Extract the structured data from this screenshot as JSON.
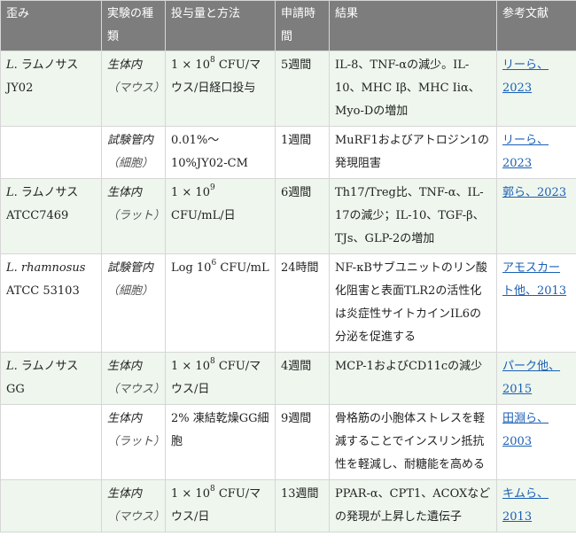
{
  "headers": [
    "歪み",
    "実験の種類",
    "投与量と方法",
    "申請時間",
    "結果",
    "参考文献"
  ],
  "rows": [
    {
      "strain_prefix": "L.",
      "strain_name": " ラムノサスJY02",
      "type_main": "生体内",
      "type_sub": "（マウス）",
      "dose_before": "1 × 10",
      "dose_sup": "8",
      "dose_after": " CFU/マウス/日経口投与",
      "duration": "5週間",
      "result": "IL-8、TNF-αの減少。IL-10、MHC Iβ、MHC Iiα、Myo-Dの増加",
      "ref": "リーら、2023"
    },
    {
      "strain_prefix": "",
      "strain_name": "",
      "type_main": "試験管内",
      "type_sub": "（細胞）",
      "dose_before": "0.01%～10%JY02-CM",
      "dose_sup": "",
      "dose_after": "",
      "duration": "1週間",
      "result": "MuRF1およびアトロジン1の発現阻害",
      "ref": "リーら、2023"
    },
    {
      "strain_prefix": "L.",
      "strain_name": " ラムノサスATCC7469",
      "type_main": "生体内",
      "type_sub": "（ラット）",
      "dose_before": "1 × 10",
      "dose_sup": "9",
      "dose_after": " CFU/mL/日",
      "duration": "6週間",
      "result": "Th17/Treg比、TNF-α、IL-17の減少；IL-10、TGF-β、TJs、GLP-2の増加",
      "ref": "郭ら、2023"
    },
    {
      "strain_prefix": "L. rhamnosus",
      "strain_name": "ATCC 53103",
      "type_main": "試験管内",
      "type_sub": "（細胞）",
      "dose_before": "Log 10",
      "dose_sup": "6",
      "dose_after": "  CFU/mL",
      "duration": "24時間",
      "result": "NF-κBサブユニットのリン酸化阻害と表面TLR2の活性化は炎症性サイトカインIL6の分泌を促進する",
      "ref": "アモスカート他、2013"
    },
    {
      "strain_prefix": "L.",
      "strain_name": " ラムノサスGG",
      "type_main": "生体内",
      "type_sub": "（マウス）",
      "dose_before": "1 × 10",
      "dose_sup": "8",
      "dose_after": " CFU/マウス/日",
      "duration": "4週間",
      "result": "MCP-1およびCD11cの減少",
      "ref": "パーク他、2015"
    },
    {
      "strain_prefix": "",
      "strain_name": "",
      "type_main": "生体内",
      "type_sub": "（ラット）",
      "dose_before": "2% 凍結乾燥GG細胞",
      "dose_sup": "",
      "dose_after": "",
      "duration": "9週間",
      "result": "骨格筋の小胞体ストレスを軽減することでインスリン抵抗性を軽減し、耐糖能を高める",
      "ref": "田淵ら、2003"
    },
    {
      "strain_prefix": "",
      "strain_name": "",
      "type_main": "生体内",
      "type_sub": "（マウス）",
      "dose_before": "1 × 10",
      "dose_sup": "8",
      "dose_after": " CFU/マウス/日",
      "duration": "13週間",
      "result": "PPAR-α、CPT1、ACOXなどの発現が上昇した遺伝子",
      "ref": "キムら、2013"
    }
  ]
}
